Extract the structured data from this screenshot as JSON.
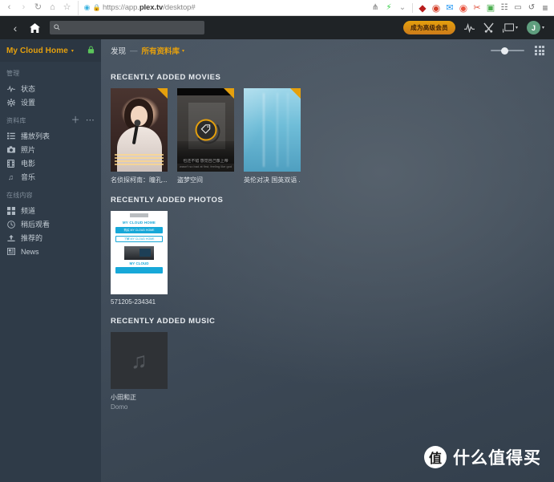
{
  "browser": {
    "nav": [
      {
        "name": "back",
        "glyph": "‹"
      },
      {
        "name": "forward",
        "glyph": "›"
      },
      {
        "name": "reload",
        "glyph": "↻"
      },
      {
        "name": "home",
        "glyph": "⌂"
      },
      {
        "name": "bookmark",
        "glyph": "☆"
      }
    ],
    "url_prefix": "https://app.",
    "url_domain": "plex.tv",
    "url_suffix": "/desktop#",
    "secure_icon": "🔒",
    "extensions": [
      {
        "name": "share-icon",
        "glyph": "⋔",
        "color": "#6b6b6b"
      },
      {
        "name": "flash-icon",
        "glyph": "⚡",
        "color": "#2ecc40"
      },
      {
        "name": "chevron-down-icon",
        "glyph": "⌄",
        "color": "#9a9a9a"
      },
      {
        "name": "shield-extension-icon",
        "glyph": "◆",
        "color": "#b81c1c"
      },
      {
        "name": "target-extension-icon",
        "glyph": "◉",
        "color": "#d4402b"
      },
      {
        "name": "mail-extension-icon",
        "glyph": "✉",
        "color": "#2196f3"
      },
      {
        "name": "eye-extension-icon",
        "glyph": "◉",
        "color": "#e8533f"
      },
      {
        "name": "scissors-extension-icon",
        "glyph": "✂",
        "color": "#e0503a"
      },
      {
        "name": "puzzle-extension-icon",
        "glyph": "▣",
        "color": "#4caf50"
      },
      {
        "name": "apps-extension-icon",
        "glyph": "☷",
        "color": "#6b6b6b"
      },
      {
        "name": "device-extension-icon",
        "glyph": "▭",
        "color": "#6b6b6b"
      },
      {
        "name": "history-extension-icon",
        "glyph": "↺",
        "color": "#6b6b6b"
      },
      {
        "name": "menu-icon",
        "glyph": "≡",
        "color": "#4a4a4a"
      }
    ]
  },
  "header": {
    "back_glyph": "‹",
    "home_glyph": "⌂",
    "search_icon": "⚲",
    "search_value": "",
    "search_placeholder": "",
    "premium_label": "成为高级会员",
    "activity_icon": "⨍",
    "tools_icon": "⚒",
    "cast_icon": "▭",
    "avatar_initial": "J",
    "caret": "▾"
  },
  "sidebar": {
    "server_name": "My Cloud Home",
    "server_caret": "▾",
    "lock_icon": "⚿",
    "groups": [
      {
        "title": "管理",
        "actions": [],
        "items": [
          {
            "label": "状态",
            "icon": "⨍",
            "name": "status"
          },
          {
            "label": "设置",
            "icon": "⚙",
            "name": "settings"
          }
        ]
      },
      {
        "title": "资料库",
        "actions": [
          {
            "name": "add-library-button",
            "glyph": "＋"
          },
          {
            "name": "library-more-button",
            "glyph": "⋯"
          }
        ],
        "items": [
          {
            "label": "播放列表",
            "icon": "☰",
            "name": "playlists"
          },
          {
            "label": "照片",
            "icon": "▣",
            "name": "photos"
          },
          {
            "label": "电影",
            "icon": "▤",
            "name": "movies"
          },
          {
            "label": "音乐",
            "icon": "♫",
            "name": "music"
          }
        ]
      },
      {
        "title": "在线内容",
        "actions": [],
        "items": [
          {
            "label": "频道",
            "icon": "▒",
            "name": "channels"
          },
          {
            "label": "稍后观看",
            "icon": "◴",
            "name": "watch-later"
          },
          {
            "label": "推荐的",
            "icon": "⤴",
            "name": "recommended"
          },
          {
            "label": "News",
            "icon": "▥",
            "name": "news"
          }
        ]
      }
    ]
  },
  "main": {
    "breadcrumb": {
      "first": "发现",
      "dash": "—",
      "second": "所有资料库",
      "caret": "▾"
    },
    "view_controls": {
      "zoom_value": 30,
      "grid_icon": "grid-view-icon"
    },
    "sections": [
      {
        "name": "recently-added-movies",
        "title": "RECENTLY ADDED MOVIES",
        "items": [
          {
            "title": "名侦探柯南：瞳孔...",
            "sub": "",
            "badge": true
          },
          {
            "title": "盗梦空间",
            "sub": "",
            "badge": true,
            "hover": true
          },
          {
            "title": "英伦对决 国英双语 ...",
            "sub": "",
            "badge": true
          }
        ]
      },
      {
        "name": "recently-added-photos",
        "title": "RECENTLY ADDED PHOTOS",
        "items": [
          {
            "title": "571205-234341",
            "sub": "",
            "badge": false
          }
        ]
      },
      {
        "name": "recently-added-music",
        "title": "RECENTLY ADDED MUSIC",
        "items": [
          {
            "title": "小田和正",
            "sub": "Domo",
            "badge": false
          }
        ]
      }
    ],
    "photo_card_art": {
      "title": "MY CLOUD HOME",
      "btn1": "购买 MY CLOUD HOME",
      "btn2": "了解 MY CLOUD HOME",
      "title2": "MY CLOUD"
    },
    "movie2_subtitle_cn": "也还不错  感觉自己像上帝",
    "movie2_subtitle_en": "wasn't so bad at first, feeling like god"
  },
  "watermark": {
    "logo_char": "值",
    "text": "什么值得买"
  },
  "colors": {
    "accent": "#e5a00d",
    "sidebar_bg": "#2f3b48",
    "header_bg": "#1f2326",
    "photo_accent": "#17a8d8"
  }
}
